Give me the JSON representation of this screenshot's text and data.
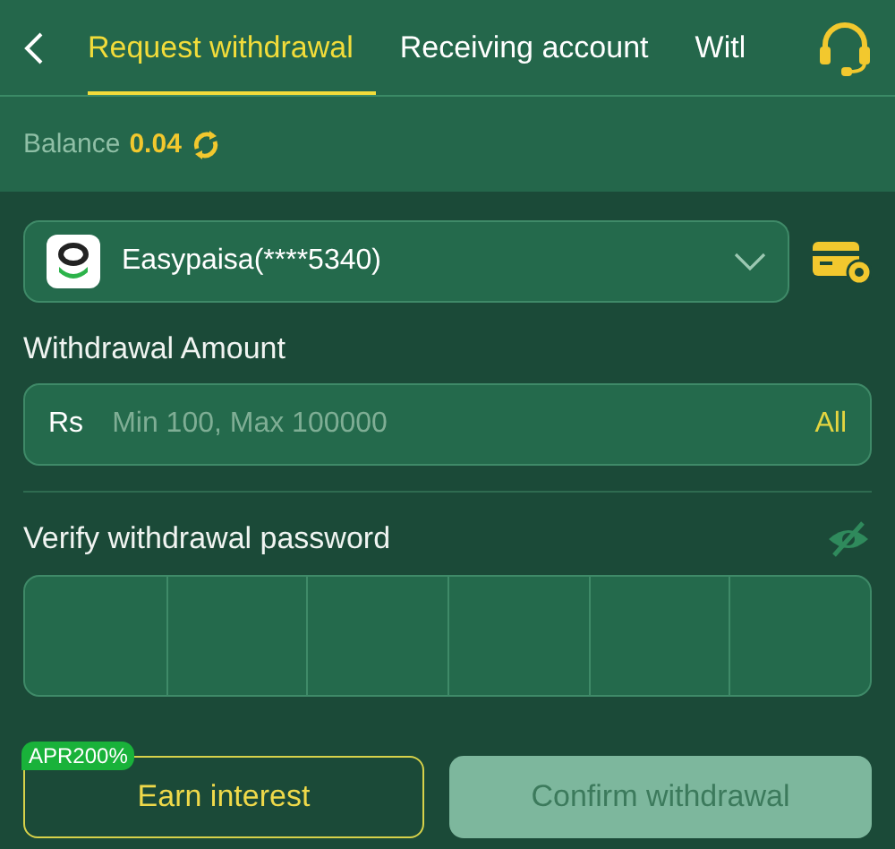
{
  "tabs": [
    {
      "label": "Request withdrawal",
      "selected": true
    },
    {
      "label": "Receiving account",
      "selected": false
    },
    {
      "label": "Witl",
      "selected": false
    }
  ],
  "balance": {
    "label": "Balance",
    "value": "0.04"
  },
  "account": {
    "name": "Easypaisa(****5340)"
  },
  "amount": {
    "label": "Withdrawal Amount",
    "currency": "Rs",
    "placeholder": "Min 100, Max 100000",
    "all_link": "All"
  },
  "password": {
    "label": "Verify withdrawal password"
  },
  "earn_button": {
    "label": "Earn interest",
    "badge": "APR200%"
  },
  "confirm_button": {
    "label": "Confirm withdrawal",
    "disabled": true
  }
}
